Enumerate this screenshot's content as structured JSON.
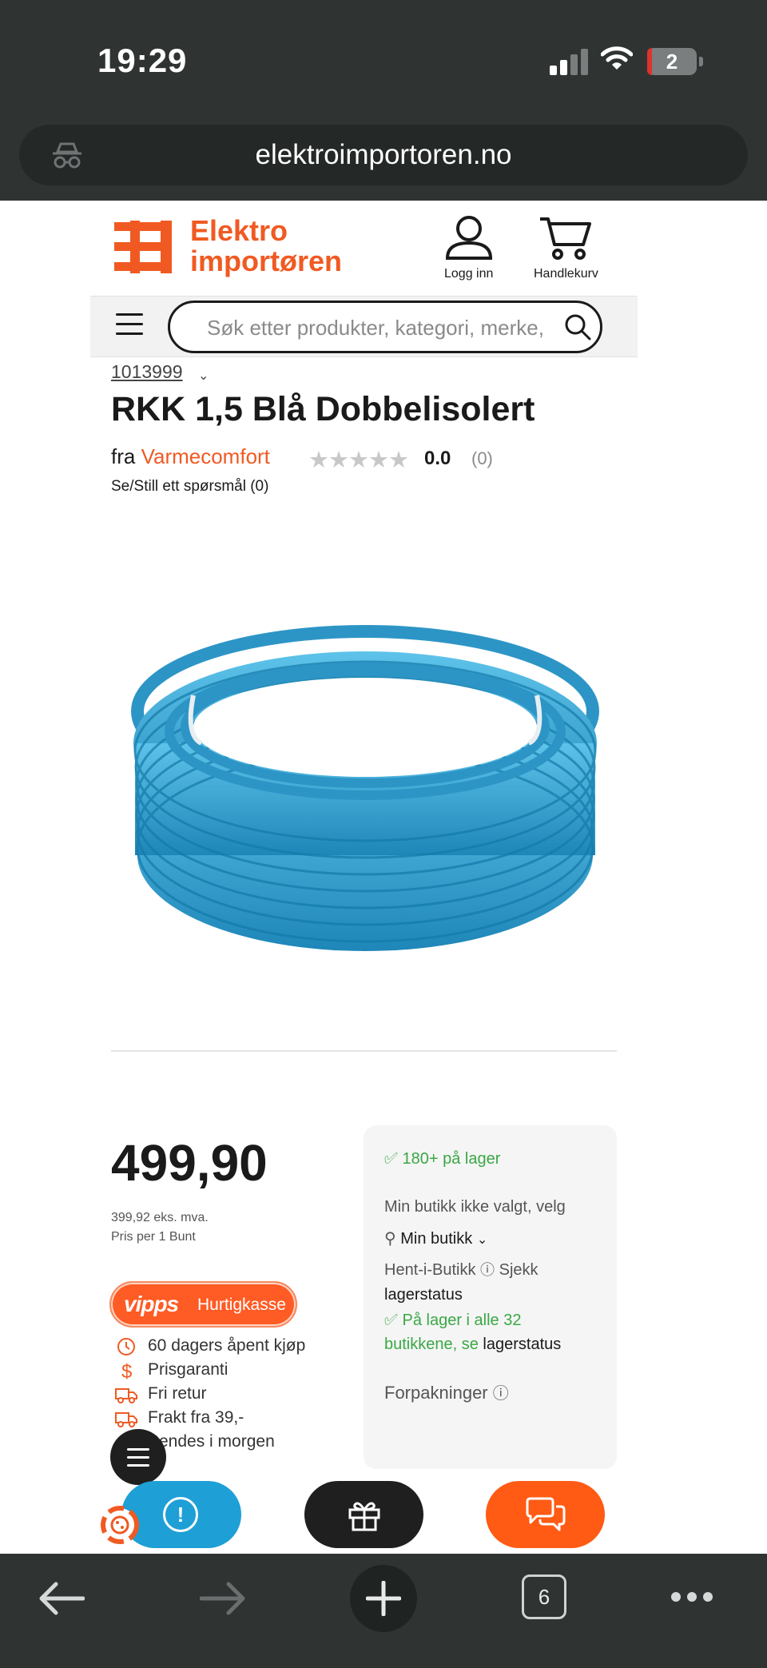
{
  "status_bar": {
    "time": "19:29",
    "battery": "2"
  },
  "browser": {
    "url": "elektroimportoren.no",
    "tab_count": "6"
  },
  "header": {
    "logo_line1": "Elektro",
    "logo_line2": "importøren",
    "login_label": "Logg inn",
    "cart_label": "Handlekurv",
    "search_placeholder": "Søk etter produkter, kategori, merke,"
  },
  "product": {
    "sku": "1013999",
    "title": "RKK 1,5 Blå Dobbelisolert",
    "brand_prefix": "fra",
    "brand": "Varmecomfort",
    "stars": "★★★★★",
    "rating": "0.0",
    "rating_count": "(0)",
    "rating_value": 0,
    "question_link": "Se/Still ett spørsmål (0)"
  },
  "pricing": {
    "price": "499,90",
    "price_ex_vat": "399,92 eks. mva.",
    "price_per": "Pris per 1 Bunt",
    "vipps_brand": "vipps",
    "vipps_label": "Hurtigkasse"
  },
  "features": [
    {
      "icon": "clock-icon",
      "label": "60 dagers åpent kjøp"
    },
    {
      "icon": "dollar-icon",
      "label": "Prisgaranti"
    },
    {
      "icon": "truck-icon",
      "label": "Fri retur"
    },
    {
      "icon": "truck-icon",
      "label": "Frakt fra 39,-"
    },
    {
      "icon": "truck-icon",
      "label": "Sendes i morgen"
    }
  ],
  "stock": {
    "online": "180+ på lager",
    "store_note": "Min butikk ikke valgt, velg",
    "my_store": "Min butikk",
    "pickup_label": "Hent-i-Butikk",
    "check_label": "Sjekk",
    "stock_status_link": "lagerstatus",
    "all_stores_line1": "På lager i alle 32",
    "all_stores_line2": "butikkene, se",
    "all_stores_link": "lagerstatus",
    "packaging": "Forpakninger"
  },
  "colors": {
    "brand_orange": "#f05a22",
    "chrome_bg": "#2f3433",
    "stock_green": "#3aa845",
    "info_blue": "#1e9fd6",
    "vipps_orange": "#ff5b24"
  }
}
